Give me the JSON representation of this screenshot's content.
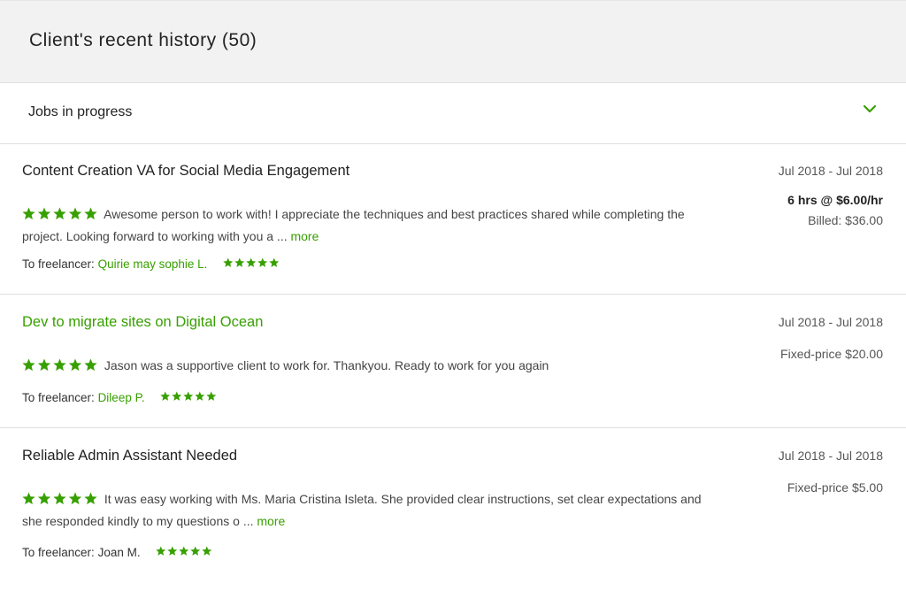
{
  "header": {
    "title": "Client's recent history (50)"
  },
  "filter": {
    "label": "Jobs in progress",
    "icon": "chevron-down-icon"
  },
  "colors": {
    "accent": "#37a000",
    "header_bg": "#f2f2f2",
    "divider": "#e0e0e0"
  },
  "jobs": [
    {
      "title": "Content Creation VA for Social Media Engagement",
      "dates": "Jul 2018 - Jul 2018",
      "rate": "6 hrs @ $6.00/hr",
      "billed": "Billed: $36.00",
      "review_rating": 5,
      "review_text": "Awesome person to work with! I appreciate the techniques and best practices shared while completing the project. Looking forward to working with you a ...",
      "more_label": "more",
      "freelancer_prefix": "To freelancer:",
      "freelancer_name": "Quirie may sophie L.",
      "freelancer_rating": 5
    },
    {
      "title": "Dev to migrate sites on Digital Ocean",
      "dates": "Jul 2018 - Jul 2018",
      "price": "Fixed-price $20.00",
      "review_rating": 5,
      "review_text": "Jason was a supportive client to work for. Thankyou. Ready to work for you again",
      "freelancer_prefix": "To freelancer:",
      "freelancer_name": "Dileep P.",
      "freelancer_rating": 5
    },
    {
      "title": "Reliable Admin Assistant Needed",
      "dates": "Jul 2018 - Jul 2018",
      "price": "Fixed-price $5.00",
      "review_rating": 5,
      "review_text": "It was easy working with Ms. Maria Cristina Isleta. She provided clear instructions, set clear expectations and she responded kindly to my questions o ...",
      "more_label": "more",
      "freelancer_prefix": "To freelancer:",
      "freelancer_name": "Joan M.",
      "freelancer_rating": 5
    }
  ]
}
